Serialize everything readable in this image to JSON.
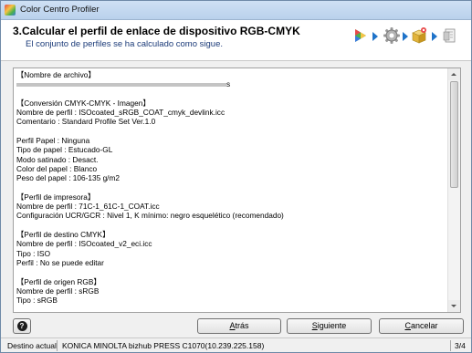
{
  "window": {
    "title": "Color Centro Profiler"
  },
  "header": {
    "step_title": "3.Calcular el perfil de enlace de dispositivo RGB-CMYK",
    "step_subtitle": "El conjunto de perfiles se ha calculado como sigue."
  },
  "wizard_icons": [
    "profile-color-icon",
    "gear-icon",
    "package-icon",
    "export-icon"
  ],
  "content": {
    "lines": [
      "【Nombre de archivo】",
      "__REDACTED__s",
      "",
      "【Conversión CMYK-CMYK - Imagen】",
      "Nombre de perfil : ISOcoated_sRGB_COAT_cmyk_devlink.icc",
      "Comentario : Standard Profile Set Ver.1.0",
      "",
      "Perfil Papel : Ninguna",
      "Tipo de papel : Estucado-GL",
      "Modo satinado : Desact.",
      "Color del papel : Blanco",
      "Peso del papel : 106-135 g/m2",
      "",
      "【Perfil de impresora】",
      "Nombre de perfil : 71C-1_61C-1_COAT.icc",
      "Configuración UCR/GCR : Nivel 1, K mínimo: negro esquelético (recomendado)",
      "",
      "【Perfil de destino CMYK】",
      "Nombre de perfil : ISOcoated_v2_eci.icc",
      "Tipo : ISO",
      "Perfil : No se puede editar",
      "",
      "【Perfil de origen RGB】",
      "Nombre de perfil : sRGB",
      "Tipo : sRGB"
    ]
  },
  "buttons": {
    "help": "?",
    "back_u": "A",
    "back_rest": "trás",
    "next_u": "S",
    "next_rest": "iguiente",
    "cancel_u": "C",
    "cancel_rest": "ancelar"
  },
  "status": {
    "label": "Destino actual",
    "printer": "KONICA MINOLTA bizhub PRESS C1070(10.239.225.158)",
    "page": "3/4"
  },
  "colors": {
    "accent": "#1f73c9",
    "subtitle": "#1a3a78"
  }
}
